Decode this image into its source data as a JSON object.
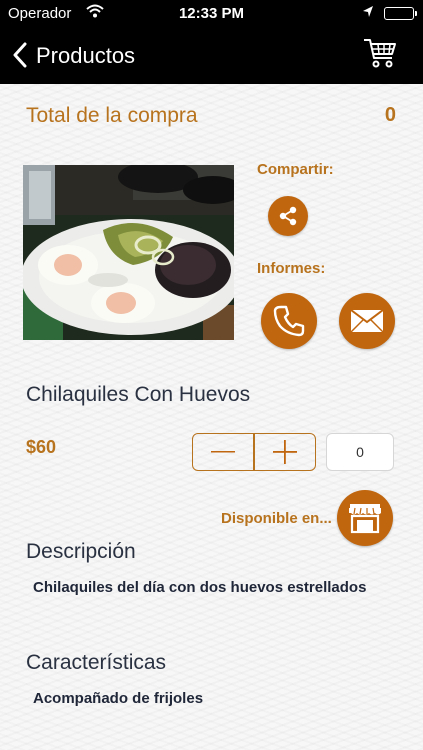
{
  "status_bar": {
    "carrier": "Operador",
    "time": "12:33 PM"
  },
  "nav": {
    "back_label": "Productos",
    "cart_icon": "cart-icon"
  },
  "summary": {
    "total_label": "Total de la compra",
    "total_value": "0"
  },
  "actions": {
    "share_label": "Compartir:",
    "info_label": "Informes:",
    "available_label": "Disponible en..."
  },
  "product": {
    "name": "Chilaquiles Con Huevos",
    "price": "$60",
    "quantity": "0"
  },
  "description": {
    "title": "Descripción",
    "text": "Chilaquiles del día con dos huevos estrellados"
  },
  "features": {
    "title": "Características",
    "text": "Acompañado de frijoles"
  },
  "colors": {
    "accent": "#c0660f",
    "accent_text": "#b8731e",
    "title_text": "#2a3242",
    "nav_background": "#000000"
  }
}
